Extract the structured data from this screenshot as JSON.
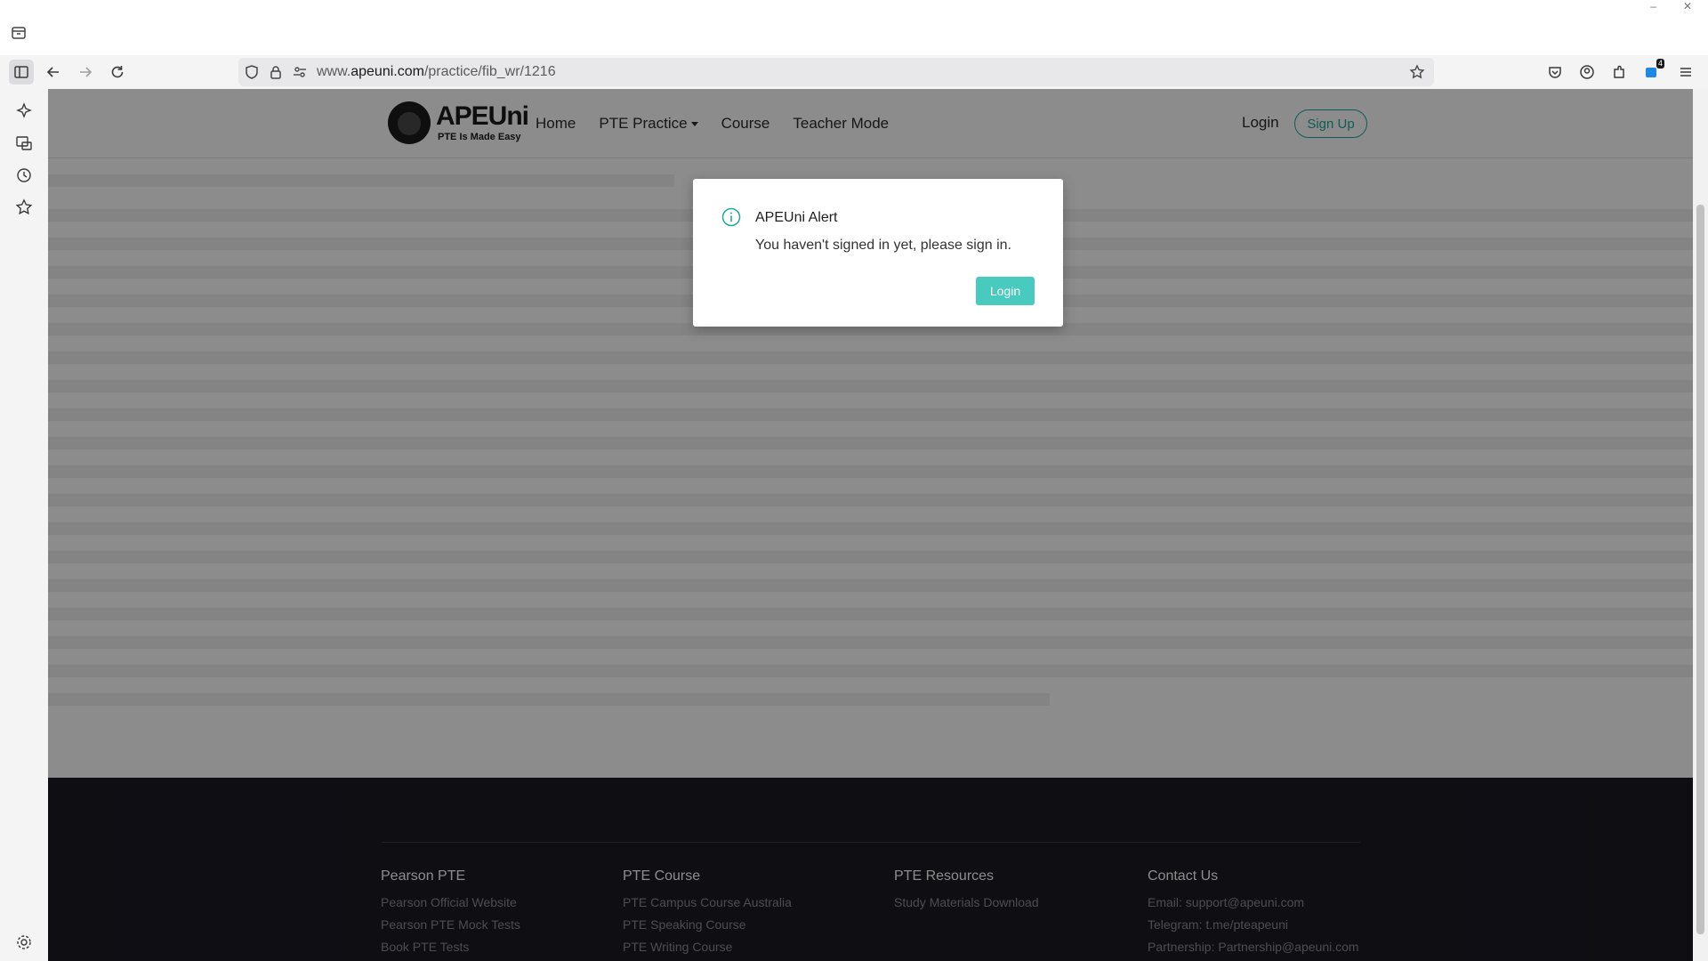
{
  "browser": {
    "url_prefix": "www.",
    "url_domain": "apeuni.com",
    "url_path": "/practice/fib_wr/1216",
    "extensions_badge": "4"
  },
  "site": {
    "brand": "APEUni",
    "tagline": "PTE Is Made Easy",
    "nav": [
      "Home",
      "PTE Practice",
      "Course",
      "Teacher Mode"
    ],
    "login": "Login",
    "signup": "Sign Up",
    "accent_color": "#20a89b"
  },
  "modal": {
    "title": "APEUni Alert",
    "message": "You haven't signed in yet, please sign in.",
    "button": "Login"
  },
  "footer": {
    "columns": [
      {
        "heading": "Pearson PTE",
        "links": [
          "Pearson Official Website",
          "Pearson PTE Mock Tests",
          "Book PTE Tests"
        ]
      },
      {
        "heading": "PTE Course",
        "links": [
          "PTE Campus Course Australia",
          "PTE Speaking Course",
          "PTE Writing Course"
        ]
      },
      {
        "heading": "PTE Resources",
        "links": [
          "Study Materials Download"
        ]
      },
      {
        "heading": "Contact Us",
        "links": [
          "Email: support@apeuni.com",
          "Telegram: t.me/pteapeuni",
          "Partnership: Partnership@apeuni.com"
        ]
      }
    ]
  }
}
